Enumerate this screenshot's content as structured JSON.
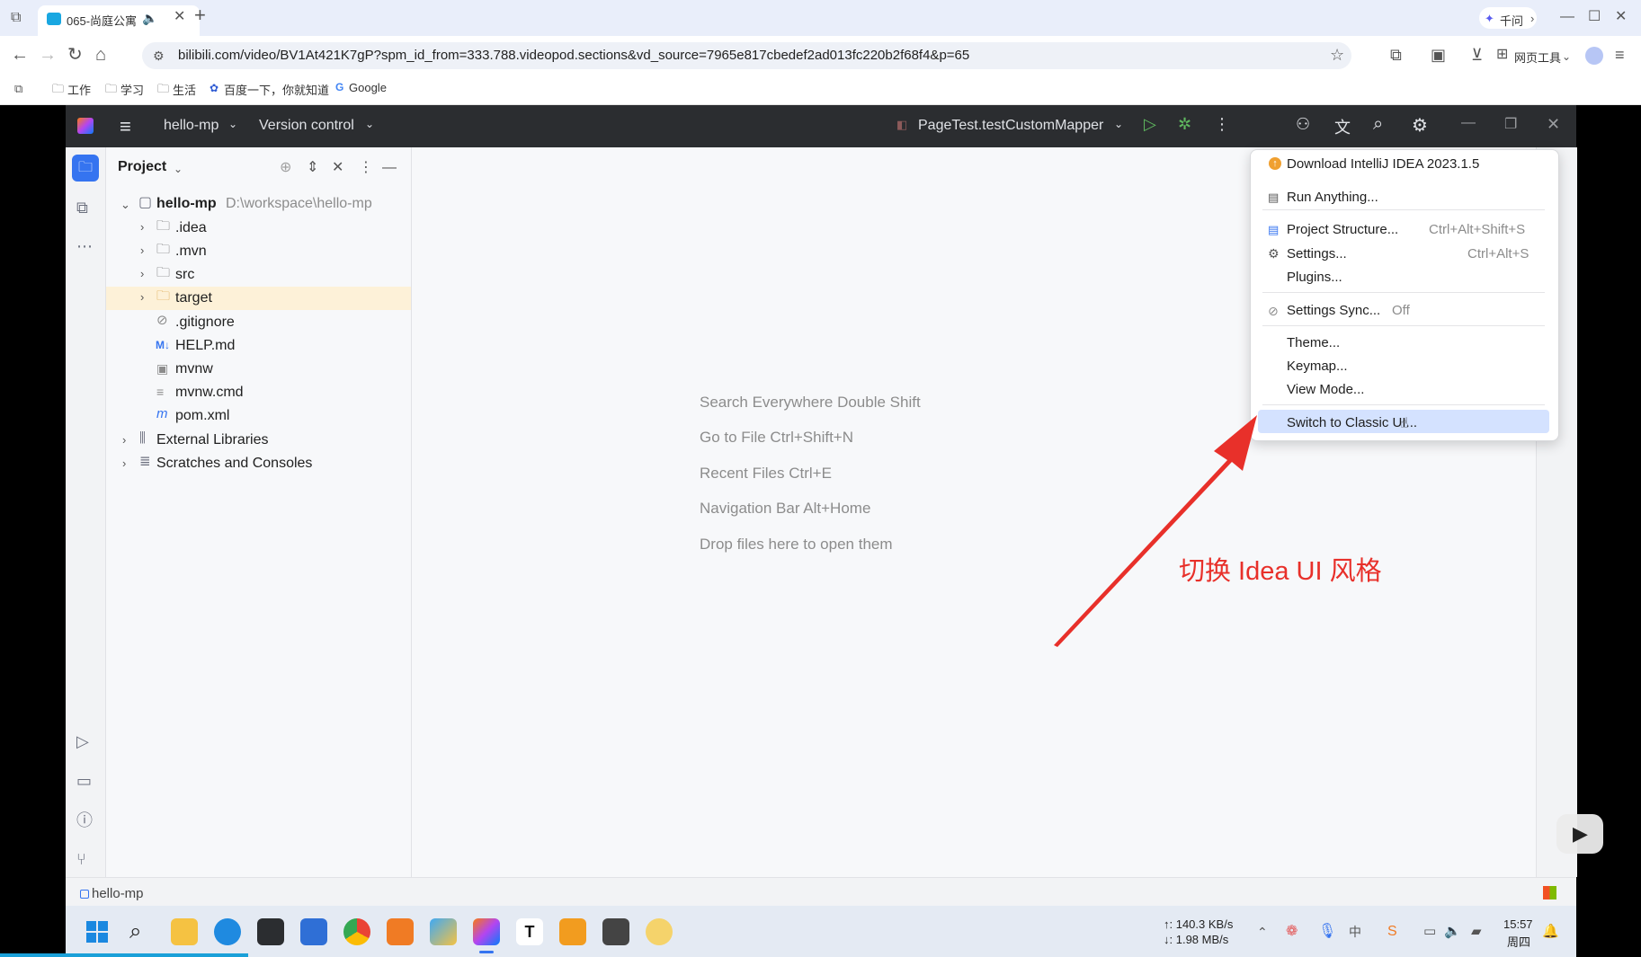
{
  "browser": {
    "tab_title": "065-尚庭公寓",
    "qianwen": "千问",
    "url": "bilibili.com/video/BV1At421K7gP?spm_id_from=333.788.videopod.sections&vd_source=7965e817cbedef2ad013fc220b2f68f4&p=65",
    "web_tools": "网页工具",
    "bookmarks": [
      "工作",
      "学习",
      "生活",
      "百度一下，你就知道",
      "Google"
    ]
  },
  "ide": {
    "project_name": "hello-mp",
    "vcs": "Version control",
    "run_config": "PageTest.testCustomMapper",
    "panel_title": "Project",
    "tree": {
      "root_name": "hello-mp",
      "root_path": "D:\\workspace\\hello-mp",
      "items": [
        ".idea",
        ".mvn",
        "src",
        "target",
        ".gitignore",
        "HELP.md",
        "mvnw",
        "mvnw.cmd",
        "pom.xml"
      ],
      "external": "External Libraries",
      "scratches": "Scratches and Consoles"
    },
    "hints": [
      "Search Everywhere Double Shift",
      "Go to File Ctrl+Shift+N",
      "Recent Files Ctrl+E",
      "Navigation Bar Alt+Home",
      "Drop files here to open them"
    ],
    "status_project": "hello-mp"
  },
  "menu": {
    "download": "Download IntelliJ IDEA 2023.1.5",
    "run_anything": "Run Anything...",
    "project_structure": "Project Structure...",
    "project_structure_sc": "Ctrl+Alt+Shift+S",
    "settings": "Settings...",
    "settings_sc": "Ctrl+Alt+S",
    "plugins": "Plugins...",
    "settings_sync": "Settings Sync...",
    "settings_sync_state": "Off",
    "theme": "Theme...",
    "keymap": "Keymap...",
    "view_mode": "View Mode...",
    "switch_classic": "Switch to Classic UI..."
  },
  "annotation": {
    "text": "切换 Idea UI 风格",
    "color": "#e8302a"
  },
  "taskbar": {
    "net_up": "↑: 140.3 KB/s",
    "net_down": "↓: 1.98 MB/s",
    "time": "15:57",
    "day": "周四"
  }
}
